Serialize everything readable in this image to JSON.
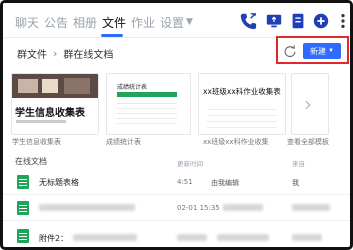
{
  "tabs": [
    {
      "label": "聊天",
      "active": false
    },
    {
      "label": "公告",
      "active": false
    },
    {
      "label": "相册",
      "active": false
    },
    {
      "label": "文件",
      "active": true
    },
    {
      "label": "作业",
      "active": false
    },
    {
      "label": "设置",
      "active": false
    }
  ],
  "colors": {
    "accent": "#2f6bff",
    "highlight": "#e0292e",
    "sheet": "#22a35a"
  },
  "breadcrumb": {
    "root": "群文件",
    "current": "群在线文档"
  },
  "actions": {
    "new_label": "新建"
  },
  "templates": [
    {
      "label": "学生信息收集表",
      "preview_title": "学生信息收集表"
    },
    {
      "label": "成绩统计表",
      "preview_title": "成绩统计表"
    },
    {
      "label": "xx班级xx科作业收集",
      "preview_title": "xx班级xx科作业收集表"
    },
    {
      "label": "查看全部模板"
    }
  ],
  "list": {
    "title": "在线文档",
    "columns": {
      "updated": "更新时间",
      "source": "来自"
    },
    "rows": [
      {
        "name": "无标题表格",
        "time": "4:51",
        "who": "由我编辑",
        "source": "我"
      },
      {
        "name": "",
        "time": "02-01 15:35",
        "who": "",
        "source": ""
      },
      {
        "name": "附件2：",
        "time": "",
        "who": "",
        "source": ""
      }
    ]
  }
}
